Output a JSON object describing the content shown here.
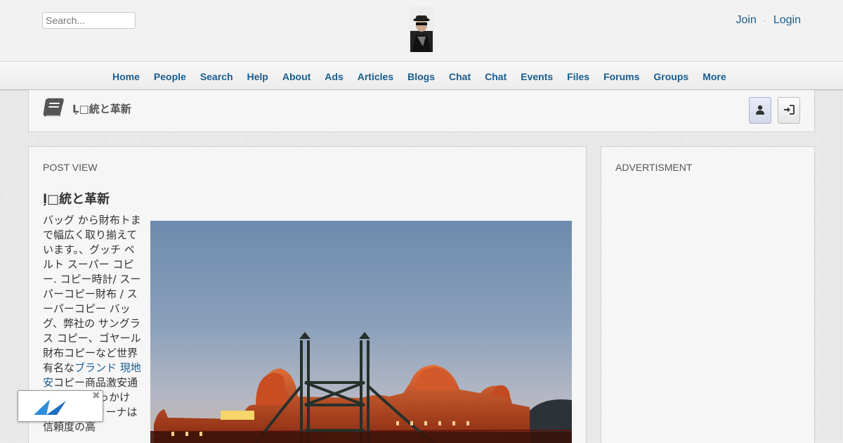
{
  "header": {
    "search_placeholder": "Search...",
    "join_label": "Join",
    "separator": "·",
    "login_label": "Login"
  },
  "nav": {
    "items": [
      "Home",
      "People",
      "Search",
      "Help",
      "About",
      "Ads",
      "Articles",
      "Blogs",
      "Chat",
      "Chat",
      "Events",
      "Files",
      "Forums",
      "Groups",
      "More"
    ]
  },
  "page_header": {
    "title": "Ļ□統と革新"
  },
  "post": {
    "section_label": "POST VIEW",
    "title": "ļ□統と革新",
    "body_before": "バッグ から財布トまで幅広く取り揃えています。、グッチ ベルト スーパー コピー. コピー時計/ スーパーコピー財布 / スーパーコピー バッグ、弊社の サングラス コピー、ゴヤール 財布コピーなど世界有名な",
    "link_text": "ブランド 現地安",
    "body_after": "コピー商品激安通販 これをきっかけに、サブマリーナは信頼度の高"
  },
  "sidebar": {
    "section_label": "ADVERTISMENT"
  },
  "colors": {
    "link": "#1a5d8f",
    "panel": "#f6f6f6",
    "background": "#e8e8e8"
  },
  "icons": [
    "book-icon",
    "user-icon",
    "sign-in-icon",
    "close-icon"
  ]
}
